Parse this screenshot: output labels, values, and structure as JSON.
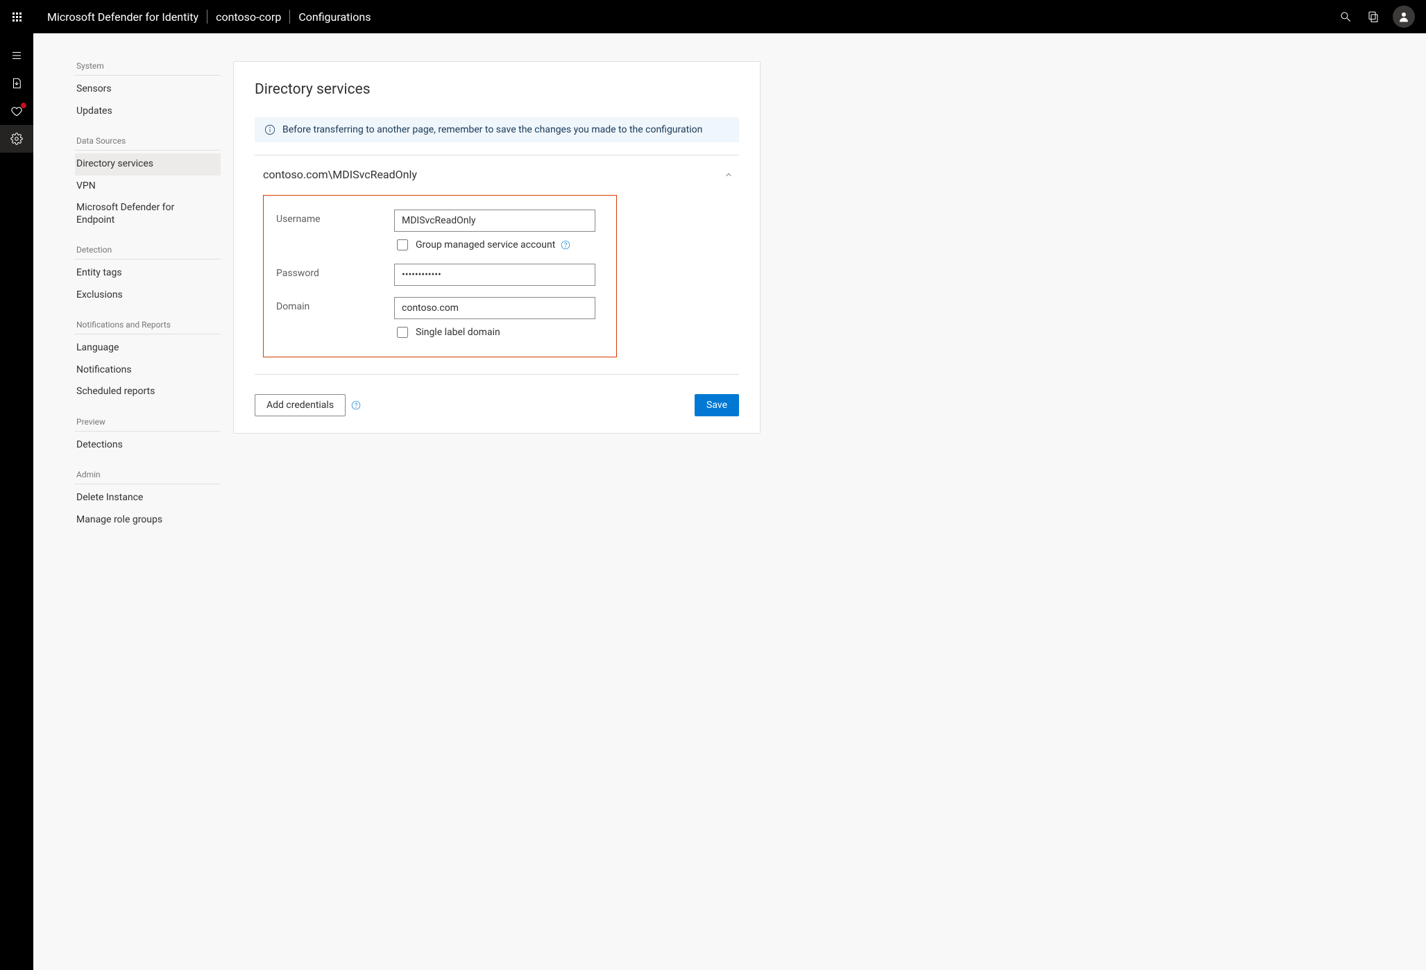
{
  "header": {
    "product": "Microsoft Defender for Identity",
    "tenant": "contoso-corp",
    "section": "Configurations"
  },
  "leftrail": {
    "items": [
      {
        "name": "list-icon"
      },
      {
        "name": "page-download-icon"
      },
      {
        "name": "health-icon",
        "badge": true
      },
      {
        "name": "gear-icon",
        "active": true
      }
    ]
  },
  "sidebar": {
    "groups": [
      {
        "header": "System",
        "items": [
          "Sensors",
          "Updates"
        ]
      },
      {
        "header": "Data Sources",
        "items": [
          "Directory services",
          "VPN",
          "Microsoft Defender for Endpoint"
        ],
        "activeIndex": 0
      },
      {
        "header": "Detection",
        "items": [
          "Entity tags",
          "Exclusions"
        ]
      },
      {
        "header": "Notifications and Reports",
        "items": [
          "Language",
          "Notifications",
          "Scheduled reports"
        ]
      },
      {
        "header": "Preview",
        "items": [
          "Detections"
        ]
      },
      {
        "header": "Admin",
        "items": [
          "Delete Instance",
          "Manage role groups"
        ]
      }
    ]
  },
  "main": {
    "title": "Directory services",
    "banner": "Before transferring to another page, remember to save the changes you made to the configuration",
    "account": {
      "title": "contoso.com\\MDISvcReadOnly",
      "fields": {
        "username_label": "Username",
        "username_value": "MDISvcReadOnly",
        "gmsa_label": "Group managed service account",
        "gmsa_checked": false,
        "password_label": "Password",
        "password_value": "••••••••••••",
        "domain_label": "Domain",
        "domain_value": "contoso.com",
        "sld_label": "Single label domain",
        "sld_checked": false
      }
    },
    "actions": {
      "add_label": "Add credentials",
      "save_label": "Save"
    }
  }
}
